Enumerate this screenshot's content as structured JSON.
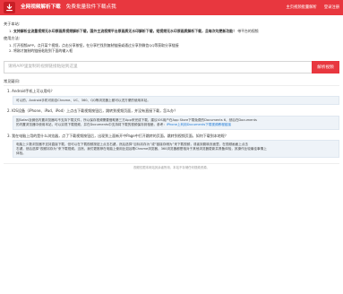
{
  "header": {
    "site_title": "全网视频解析下载",
    "tagline": "免费批量软件下载点我",
    "nav": [
      "主页视频批量解析",
      "登录注册"
    ],
    "accent_color": "#e8373f",
    "logo_icon": "download-icon"
  },
  "intro": {
    "label": "关于本站:",
    "item1_num": "1.",
    "item1_bold": "支持解析全流量视频无水印原画质视频解析下载，国外主流视频平台原画质无水印解析下载，短视频无水印原画质解析下载，且每次均更新功能！",
    "item1_tail": "带平台的视频"
  },
  "usage": {
    "label": "使用方法:",
    "steps": [
      "1. 打开视频APP，点开某个视频，点击分享按钮，在分享栏找到复制链接或通过分享到微信QQ等获取分享链接",
      "2. 将刚才复制的链接粘贴到下面的输入框"
    ]
  },
  "search": {
    "placeholder": "请将APP里复制的视频链接粘贴到这里",
    "button_label": "解析视频"
  },
  "faq": {
    "title": "常见疑问:",
    "items": [
      {
        "question": "1. Android手机上可以用吗？",
        "answer": [
          "可以的，Android手机可用自Chrome、UC、360、QQ等浏览器上都可以进方便的使用本站。"
        ]
      },
      {
        "question": "2. IOS设备（iPhone、iPad、iPod）上点击下载视频按钮后，跳转到视频页面，并没有直接下载，怎么办？",
        "answer": [
          "因Safari及微信内置浏览器均不支持下载文件，所以保存视频需要借助第三方App来完成下载，建议iOS用户在App Store下载免费的Documents 6，然后在Documents",
          "的内置浏览器中使用本站，可以实现下载视频，并在Documents中支持将下载的视频保存到相册。参考：",
          "iPhone上利用Documents下载视频教程链接"
        ]
      },
      {
        "question": "3. 我在电脑上用的是什么浏览器，点了下载视频按钮后，出现到上面新开中Page中打开跳转的页面，跳转到视频页面，如何下载到本地呢？",
        "answer": [
          "电脑上少数浏览器不支持直接下载，但可以在下载视频按钮上点击右键，然后选择“目标另存为”或“链接存储为”来下载视频，或者到跳转页面里，在视频画面上点击",
          "右键，然后选择“视频另存为”来下载视频。当然，我们更推荐在电脑上使用比如谷歌Chrome浏览器，360浏览器都是相对于其他浏览器更新并具备体验，其操作比较最佳事情上",
          "体验。"
        ]
      }
    ]
  },
  "footer": {
    "text": "视频仅限本网站其余者所用，本站不存储任何视频资源。"
  }
}
